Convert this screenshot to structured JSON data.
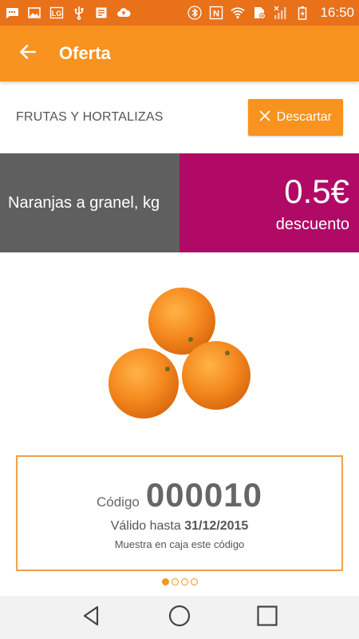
{
  "status_bar": {
    "time": "16:50",
    "icons_left": [
      "message-icon",
      "image-icon",
      "lg-icon",
      "usb-icon",
      "document-icon",
      "cloud-upload-icon"
    ],
    "icons_right": [
      "bluetooth-icon",
      "nfc-icon",
      "wifi-icon",
      "sim-icon",
      "signal-icon",
      "battery-icon"
    ],
    "lg_text": "LG",
    "nfc_text": "N"
  },
  "app_bar": {
    "title": "Oferta",
    "back_icon": "arrow-left-icon"
  },
  "category": {
    "label": "FRUTAS Y HORTALIZAS",
    "discard_button": "Descartar"
  },
  "product": {
    "name": "Naranjas a granel, kg",
    "price": "0.5€",
    "price_label": "descuento",
    "image": "oranges"
  },
  "coupon": {
    "code_label": "Código",
    "code_value": "000010",
    "valid_label": "Válido hasta",
    "valid_date": "31/12/2015",
    "note": "Muestra en caja este código"
  },
  "pager": {
    "count": 4,
    "active_index": 0
  },
  "nav_bar": {
    "buttons": [
      "back-triangle-icon",
      "home-circle-icon",
      "recent-square-icon"
    ]
  },
  "colors": {
    "accent": "#f7931e",
    "status_bar": "#e8711a",
    "name_band": "#5f5f5f",
    "price_band": "#b10a66",
    "coupon_border": "#f0a04b"
  }
}
